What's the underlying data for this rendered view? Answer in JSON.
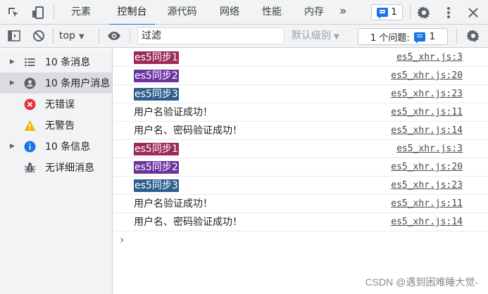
{
  "tabs": [
    {
      "label": "元素",
      "active": false
    },
    {
      "label": "控制台",
      "active": true
    },
    {
      "label": "源代码",
      "active": false
    },
    {
      "label": "网络",
      "active": false
    },
    {
      "label": "性能",
      "active": false
    },
    {
      "label": "内存",
      "active": false
    }
  ],
  "top_issue_count": "1",
  "toolbar": {
    "context": "top",
    "filter_placeholder": "过滤",
    "levels": "默认级别",
    "issues_label": "1 个问题:",
    "issues_count": "1"
  },
  "sidebar": [
    {
      "label": "10 条消息",
      "icon": "list-icon",
      "arrow": true,
      "selected": false
    },
    {
      "label": "10 条用户消息",
      "icon": "user-icon",
      "arrow": true,
      "selected": true
    },
    {
      "label": "无错误",
      "icon": "error-icon",
      "arrow": false,
      "selected": false
    },
    {
      "label": "无警告",
      "icon": "warning-icon",
      "arrow": false,
      "selected": false
    },
    {
      "label": "10 条信息",
      "icon": "info-icon",
      "arrow": true,
      "selected": false
    },
    {
      "label": "无详细消息",
      "icon": "bug-icon",
      "arrow": false,
      "selected": false
    }
  ],
  "logs": [
    {
      "text": "es5同步1",
      "badge": "#9c2b5b",
      "source": "es5_xhr.js:3"
    },
    {
      "text": "es5同步2",
      "badge": "#6b35a0",
      "source": "es5_xhr.js:20"
    },
    {
      "text": "es5同步3",
      "badge": "#2f5f8e",
      "source": "es5_xhr.js:23"
    },
    {
      "text": "用户名验证成功！",
      "badge": null,
      "source": "es5_xhr.js:11"
    },
    {
      "text": "用户名、密码验证成功！",
      "badge": null,
      "source": "es5_xhr.js:14"
    },
    {
      "text": "es5同步1",
      "badge": "#9c2b5b",
      "source": "es5_xhr.js:3"
    },
    {
      "text": "es5同步2",
      "badge": "#6b35a0",
      "source": "es5_xhr.js:20"
    },
    {
      "text": "es5同步3",
      "badge": "#2f5f8e",
      "source": "es5_xhr.js:23"
    },
    {
      "text": "用户名验证成功！",
      "badge": null,
      "source": "es5_xhr.js:11"
    },
    {
      "text": "用户名、密码验证成功！",
      "badge": null,
      "source": "es5_xhr.js:14"
    }
  ],
  "prompt_symbol": "›",
  "watermark": "CSDN @遇到困难睡大觉-"
}
